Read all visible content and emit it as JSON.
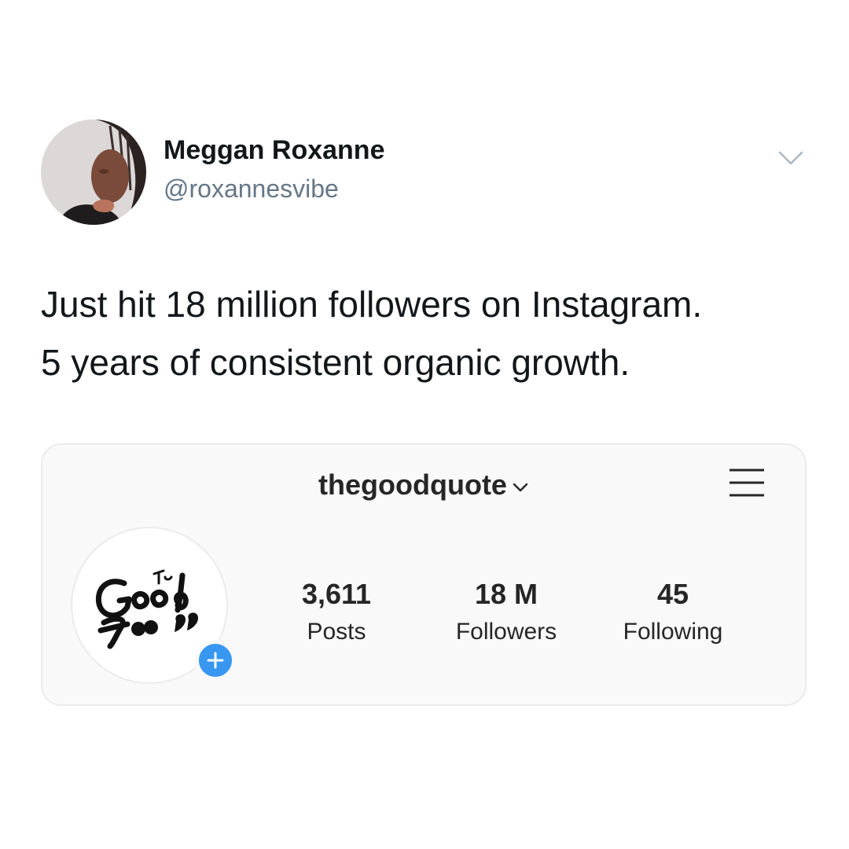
{
  "tweet": {
    "author_name": "Meggan Roxanne",
    "author_handle": "@roxannesvibe",
    "text_lines": [
      "Just hit 18 million followers on Instagram.",
      "5 years of consistent organic growth."
    ],
    "menu_icon": "chevron-down-icon"
  },
  "instagram": {
    "username": "thegoodquote",
    "menu_icon": "hamburger-menu-icon",
    "add_icon": "plus-icon",
    "stats": [
      {
        "value": "3,611",
        "label": "Posts"
      },
      {
        "value": "18 M",
        "label": "Followers"
      },
      {
        "value": "45",
        "label": "Following"
      }
    ],
    "accent_color": "#3897f0"
  }
}
